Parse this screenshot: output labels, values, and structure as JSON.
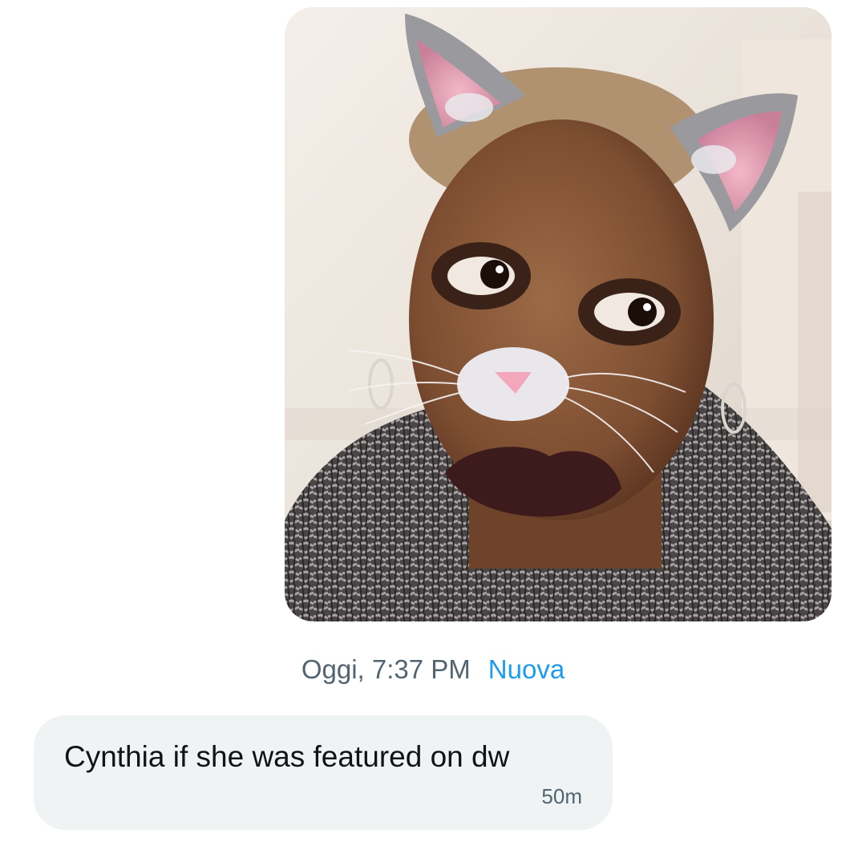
{
  "conversation": {
    "sent_message": {
      "image": {
        "description": "selfie-with-cat-ears-filter"
      },
      "timestamp": "Oggi, 7:37 PM",
      "status": "Nuova"
    },
    "received_message": {
      "text": "Cynthia if she was featured on dw",
      "age": "50m"
    }
  },
  "colors": {
    "bubble_received": "#eff3f4",
    "meta_text": "#536471",
    "status_accent": "#1d9bf0",
    "message_text": "#0f1419"
  }
}
